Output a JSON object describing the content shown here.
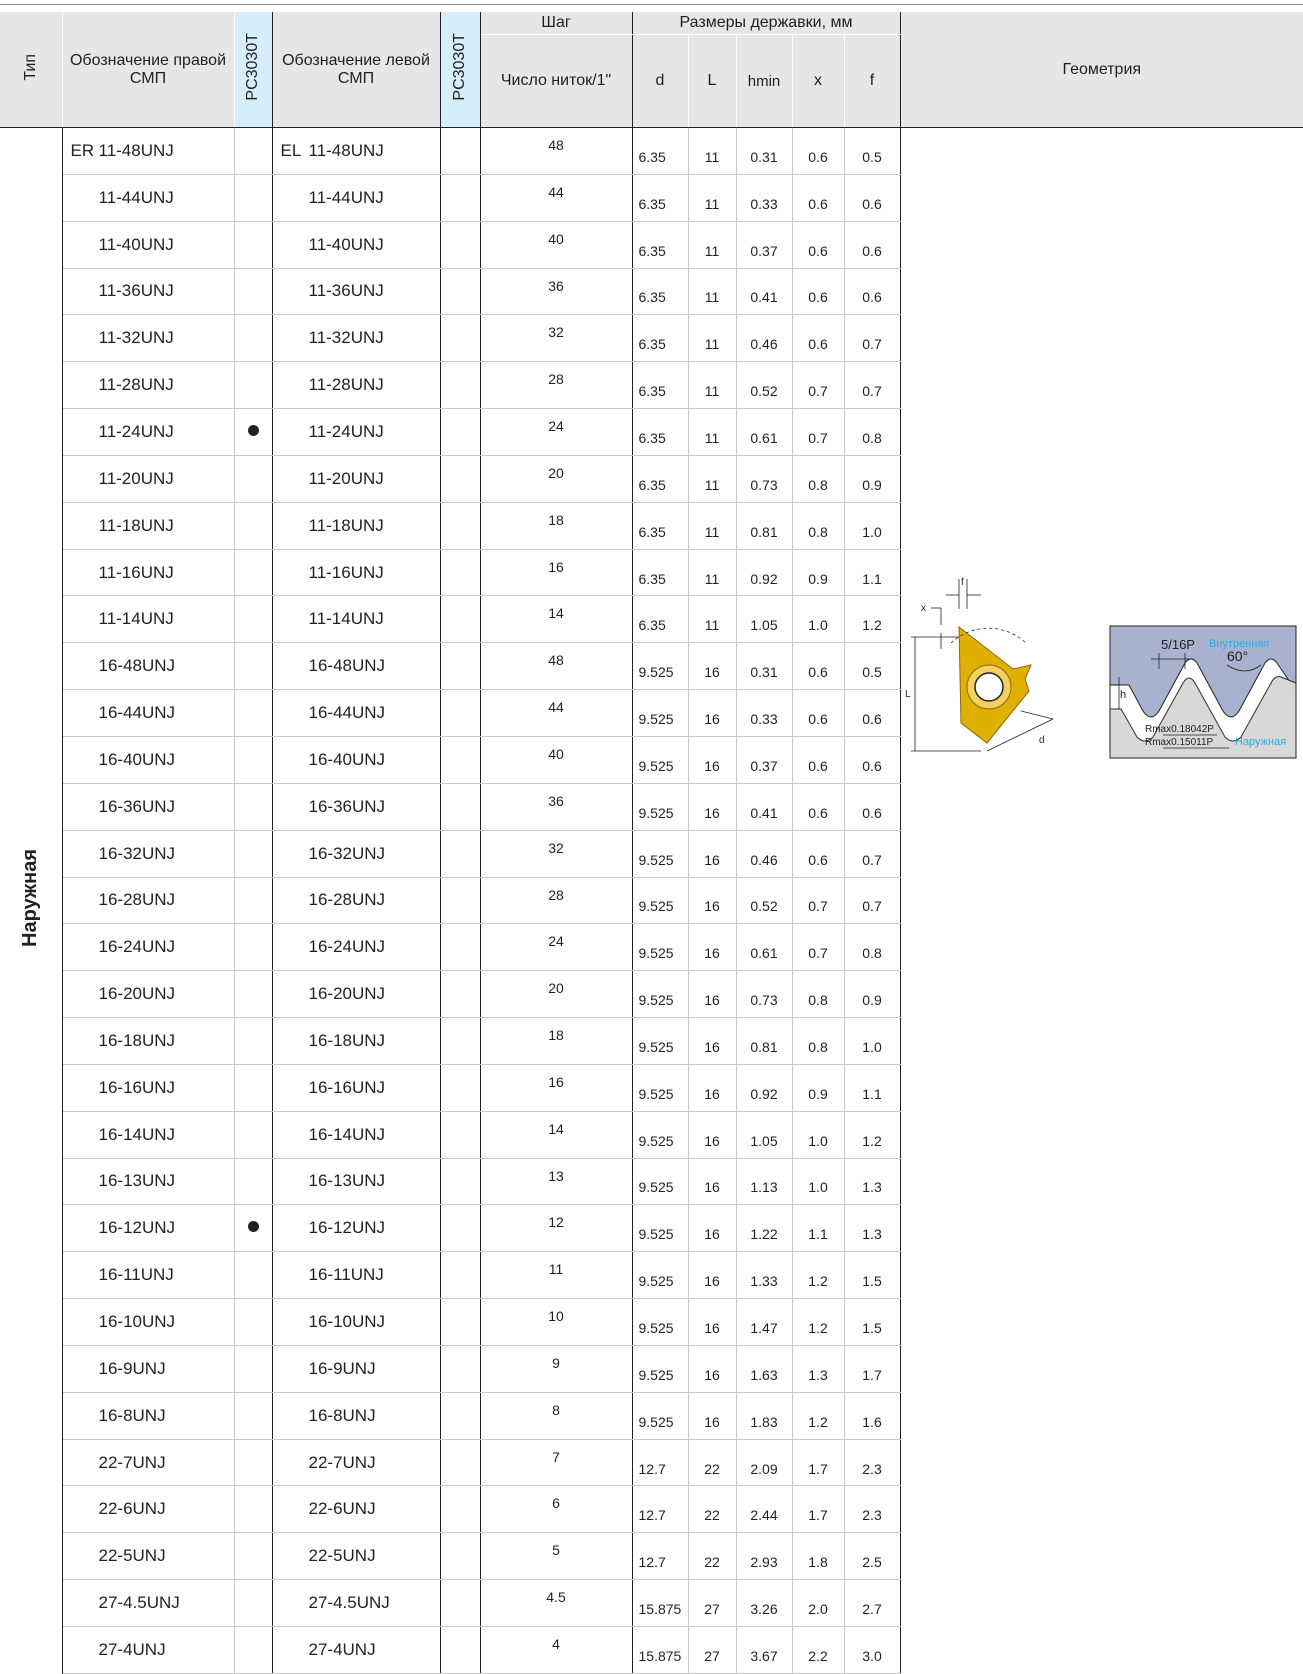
{
  "header": {
    "tip": "Тип",
    "right_designation": "Обозначение правой СМП",
    "grade_right": "PC3030T",
    "left_designation": "Обозначение левой СМП",
    "grade_left": "PC3030T",
    "pitch_top": "Шаг",
    "pitch_bottom": "Число ниток/1\"",
    "holder_dims": "Размеры державки, мм",
    "d": "d",
    "L": "L",
    "hmin": "hmin",
    "x": "x",
    "f": "f",
    "geometry": "Геометрия"
  },
  "type_label": "Наружная",
  "rows": [
    {
      "prefix_r": "ER",
      "right": "11-48UNJ",
      "dot": false,
      "prefix_l": "EL",
      "left": "11-48UNJ",
      "pitch": "48",
      "d": "6.35",
      "L": "11",
      "hmin": "0.31",
      "x": "0.6",
      "f": "0.5"
    },
    {
      "right": "11-44UNJ",
      "dot": false,
      "left": "11-44UNJ",
      "pitch": "44",
      "d": "6.35",
      "L": "11",
      "hmin": "0.33",
      "x": "0.6",
      "f": "0.6"
    },
    {
      "right": "11-40UNJ",
      "dot": false,
      "left": "11-40UNJ",
      "pitch": "40",
      "d": "6.35",
      "L": "11",
      "hmin": "0.37",
      "x": "0.6",
      "f": "0.6"
    },
    {
      "right": "11-36UNJ",
      "dot": false,
      "left": "11-36UNJ",
      "pitch": "36",
      "d": "6.35",
      "L": "11",
      "hmin": "0.41",
      "x": "0.6",
      "f": "0.6"
    },
    {
      "right": "11-32UNJ",
      "dot": false,
      "left": "11-32UNJ",
      "pitch": "32",
      "d": "6.35",
      "L": "11",
      "hmin": "0.46",
      "x": "0.6",
      "f": "0.7"
    },
    {
      "right": "11-28UNJ",
      "dot": false,
      "left": "11-28UNJ",
      "pitch": "28",
      "d": "6.35",
      "L": "11",
      "hmin": "0.52",
      "x": "0.7",
      "f": "0.7"
    },
    {
      "right": "11-24UNJ",
      "dot": true,
      "left": "11-24UNJ",
      "pitch": "24",
      "d": "6.35",
      "L": "11",
      "hmin": "0.61",
      "x": "0.7",
      "f": "0.8"
    },
    {
      "right": "11-20UNJ",
      "dot": false,
      "left": "11-20UNJ",
      "pitch": "20",
      "d": "6.35",
      "L": "11",
      "hmin": "0.73",
      "x": "0.8",
      "f": "0.9"
    },
    {
      "right": "11-18UNJ",
      "dot": false,
      "left": "11-18UNJ",
      "pitch": "18",
      "d": "6.35",
      "L": "11",
      "hmin": "0.81",
      "x": "0.8",
      "f": "1.0"
    },
    {
      "right": "11-16UNJ",
      "dot": false,
      "left": "11-16UNJ",
      "pitch": "16",
      "d": "6.35",
      "L": "11",
      "hmin": "0.92",
      "x": "0.9",
      "f": "1.1"
    },
    {
      "right": "11-14UNJ",
      "dot": false,
      "left": "11-14UNJ",
      "pitch": "14",
      "d": "6.35",
      "L": "11",
      "hmin": "1.05",
      "x": "1.0",
      "f": "1.2"
    },
    {
      "right": "16-48UNJ",
      "dot": false,
      "left": "16-48UNJ",
      "pitch": "48",
      "d": "9.525",
      "L": "16",
      "hmin": "0.31",
      "x": "0.6",
      "f": "0.5"
    },
    {
      "right": "16-44UNJ",
      "dot": false,
      "left": "16-44UNJ",
      "pitch": "44",
      "d": "9.525",
      "L": "16",
      "hmin": "0.33",
      "x": "0.6",
      "f": "0.6"
    },
    {
      "right": "16-40UNJ",
      "dot": false,
      "left": "16-40UNJ",
      "pitch": "40",
      "d": "9.525",
      "L": "16",
      "hmin": "0.37",
      "x": "0.6",
      "f": "0.6"
    },
    {
      "right": "16-36UNJ",
      "dot": false,
      "left": "16-36UNJ",
      "pitch": "36",
      "d": "9.525",
      "L": "16",
      "hmin": "0.41",
      "x": "0.6",
      "f": "0.6"
    },
    {
      "right": "16-32UNJ",
      "dot": false,
      "left": "16-32UNJ",
      "pitch": "32",
      "d": "9.525",
      "L": "16",
      "hmin": "0.46",
      "x": "0.6",
      "f": "0.7"
    },
    {
      "right": "16-28UNJ",
      "dot": false,
      "left": "16-28UNJ",
      "pitch": "28",
      "d": "9.525",
      "L": "16",
      "hmin": "0.52",
      "x": "0.7",
      "f": "0.7"
    },
    {
      "right": "16-24UNJ",
      "dot": false,
      "left": "16-24UNJ",
      "pitch": "24",
      "d": "9.525",
      "L": "16",
      "hmin": "0.61",
      "x": "0.7",
      "f": "0.8"
    },
    {
      "right": "16-20UNJ",
      "dot": false,
      "left": "16-20UNJ",
      "pitch": "20",
      "d": "9.525",
      "L": "16",
      "hmin": "0.73",
      "x": "0.8",
      "f": "0.9"
    },
    {
      "right": "16-18UNJ",
      "dot": false,
      "left": "16-18UNJ",
      "pitch": "18",
      "d": "9.525",
      "L": "16",
      "hmin": "0.81",
      "x": "0.8",
      "f": "1.0"
    },
    {
      "right": "16-16UNJ",
      "dot": false,
      "left": "16-16UNJ",
      "pitch": "16",
      "d": "9.525",
      "L": "16",
      "hmin": "0.92",
      "x": "0.9",
      "f": "1.1"
    },
    {
      "right": "16-14UNJ",
      "dot": false,
      "left": "16-14UNJ",
      "pitch": "14",
      "d": "9.525",
      "L": "16",
      "hmin": "1.05",
      "x": "1.0",
      "f": "1.2"
    },
    {
      "right": "16-13UNJ",
      "dot": false,
      "left": "16-13UNJ",
      "pitch": "13",
      "d": "9.525",
      "L": "16",
      "hmin": "1.13",
      "x": "1.0",
      "f": "1.3"
    },
    {
      "right": "16-12UNJ",
      "dot": true,
      "left": "16-12UNJ",
      "pitch": "12",
      "d": "9.525",
      "L": "16",
      "hmin": "1.22",
      "x": "1.1",
      "f": "1.3"
    },
    {
      "right": "16-11UNJ",
      "dot": false,
      "left": "16-11UNJ",
      "pitch": "11",
      "d": "9.525",
      "L": "16",
      "hmin": "1.33",
      "x": "1.2",
      "f": "1.5"
    },
    {
      "right": "16-10UNJ",
      "dot": false,
      "left": "16-10UNJ",
      "pitch": "10",
      "d": "9.525",
      "L": "16",
      "hmin": "1.47",
      "x": "1.2",
      "f": "1.5"
    },
    {
      "right": "16-9UNJ",
      "dot": false,
      "left": "16-9UNJ",
      "pitch": "9",
      "d": "9.525",
      "L": "16",
      "hmin": "1.63",
      "x": "1.3",
      "f": "1.7"
    },
    {
      "right": "16-8UNJ",
      "dot": false,
      "left": "16-8UNJ",
      "pitch": "8",
      "d": "9.525",
      "L": "16",
      "hmin": "1.83",
      "x": "1.2",
      "f": "1.6"
    },
    {
      "right": "22-7UNJ",
      "dot": false,
      "left": "22-7UNJ",
      "pitch": "7",
      "d": "12.7",
      "L": "22",
      "hmin": "2.09",
      "x": "1.7",
      "f": "2.3"
    },
    {
      "right": "22-6UNJ",
      "dot": false,
      "left": "22-6UNJ",
      "pitch": "6",
      "d": "12.7",
      "L": "22",
      "hmin": "2.44",
      "x": "1.7",
      "f": "2.3"
    },
    {
      "right": "22-5UNJ",
      "dot": false,
      "left": "22-5UNJ",
      "pitch": "5",
      "d": "12.7",
      "L": "22",
      "hmin": "2.93",
      "x": "1.8",
      "f": "2.5"
    },
    {
      "right": "27-4.5UNJ",
      "dot": false,
      "left": "27-4.5UNJ",
      "pitch": "4.5",
      "d": "15.875",
      "L": "27",
      "hmin": "3.26",
      "x": "2.0",
      "f": "2.7"
    },
    {
      "right": "27-4UNJ",
      "dot": false,
      "left": "27-4UNJ",
      "pitch": "4",
      "d": "15.875",
      "L": "27",
      "hmin": "3.67",
      "x": "2.2",
      "f": "3.0"
    }
  ],
  "geometry": {
    "insert": {
      "label_f": "f",
      "label_x": "x",
      "label_L": "L",
      "label_d": "d",
      "insert_color": "#e0b000"
    },
    "profile": {
      "pitch_label": "5/16P",
      "internal_label": "Внутренняя",
      "angle_label": "60°",
      "height_label": "h",
      "rmax_internal": "Rmax0.18042P",
      "rmax_external": "Rmax0.15011P",
      "external_label": "Наружная",
      "accent_color": "#29abe2"
    }
  }
}
